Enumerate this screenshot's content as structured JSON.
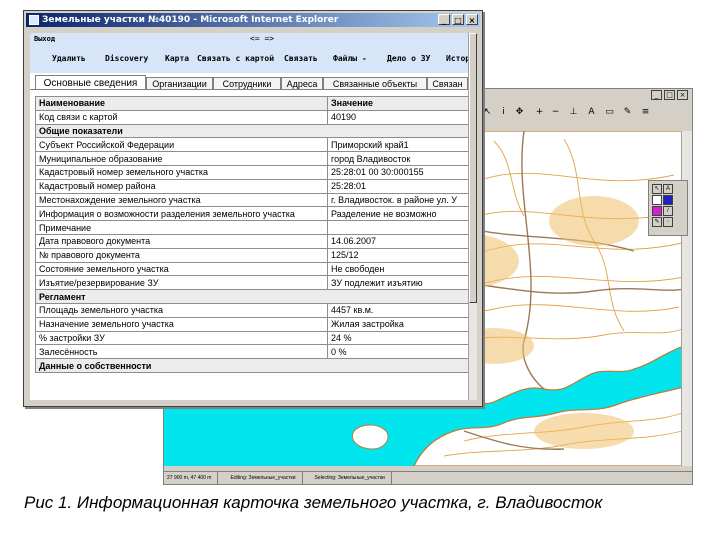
{
  "ie_window": {
    "title": "Земельные участки №40190 - Microsoft Internet Explorer",
    "controls": [
      "_",
      "□",
      "×"
    ],
    "exit_label": "Выход",
    "nav_arrows": "<= =>",
    "actions": [
      "Удалить",
      "Discovery",
      "Карта",
      "Связать с картой",
      "Связать",
      "Файлы -",
      "Дело о ЗУ",
      "Истор"
    ],
    "tabs": [
      {
        "label": "Основные сведения",
        "active": true
      },
      {
        "label": "Организации",
        "active": false
      },
      {
        "label": "Сотрудники",
        "active": false
      },
      {
        "label": "Адреса",
        "active": false
      },
      {
        "label": "Связанные объекты",
        "active": false
      },
      {
        "label": "Связан",
        "active": false
      }
    ],
    "table": {
      "header": {
        "name": "Наименование",
        "value": "Значение"
      },
      "rows": [
        {
          "name": "Код связи с картой",
          "value": "40190"
        },
        {
          "section": "Общие показатели"
        },
        {
          "name": "Субъект Российской Федерации",
          "value": "Приморский край1"
        },
        {
          "name": "Муниципальное образование",
          "value": "город Владивосток"
        },
        {
          "name": "Кадастровый номер земельного участка",
          "value": "25:28:01 00 30:000155"
        },
        {
          "name": "Кадастровый номер района",
          "value": "25:28:01"
        },
        {
          "name": "Местонахождение земельного участка",
          "value": "г. Владивосток. в районе ул. У"
        },
        {
          "name": "Информация о возможности разделения земельного участка",
          "value": "Разделение не возможно"
        },
        {
          "name": "Примечание",
          "value": ""
        },
        {
          "name": "Дата правового документа",
          "value": "14.06.2007"
        },
        {
          "name": "№ правового документа",
          "value": "125/12"
        },
        {
          "name": "Состояние земельного участка",
          "value": "Не свободен"
        },
        {
          "name": "Изъятие/резервирование ЗУ",
          "value": "ЗУ подлежит изъятию"
        },
        {
          "section": "Регламент"
        },
        {
          "name": "Площадь земельного участка",
          "value": "4457 кв.м."
        },
        {
          "name": "Назначение земельного участка",
          "value": "Жилая застройка"
        },
        {
          "name": "% застройки ЗУ",
          "value": "24 %"
        },
        {
          "name": "Залесённость",
          "value": "0 %"
        },
        {
          "section": "Данные о собственности"
        }
      ]
    }
  },
  "gis_window": {
    "controls": [
      "_",
      "□",
      "×"
    ],
    "status": [
      "27 900 m, 47 400 m",
      "Editing: Земельные_участки",
      "Selecting: Земельные_участки"
    ],
    "colors": {
      "water": "#00e5ee",
      "land": "#ffffff",
      "contours": "#e3a34a",
      "roads": "#9a7a55"
    }
  },
  "caption": "Рис 1. Информационная карточка земельного участка, г. Владивосток"
}
